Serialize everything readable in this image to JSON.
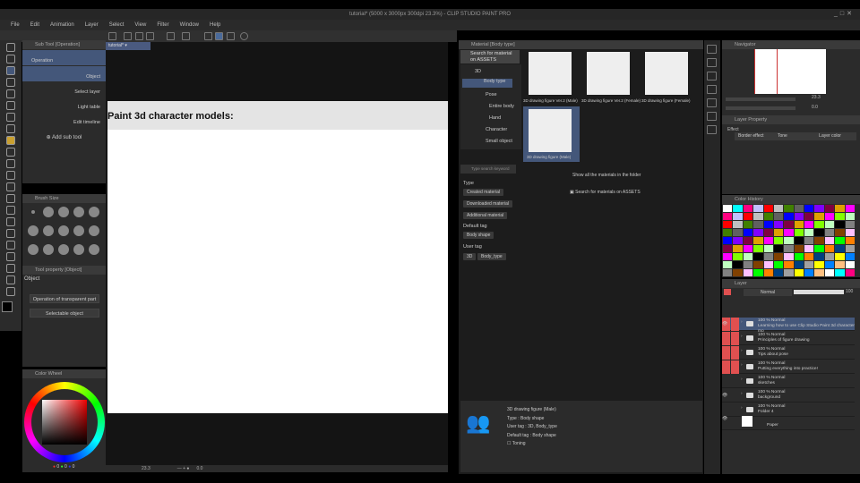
{
  "window": {
    "title": "tutorial* (5000 x 3000px 300dpi 23.3%) - CLIP STUDIO PAINT PRO",
    "controls": [
      "_",
      "□",
      "✕"
    ]
  },
  "menu": [
    "File",
    "Edit",
    "Animation",
    "Layer",
    "Select",
    "View",
    "Filter",
    "Window",
    "Help"
  ],
  "canvas_tab": "tutorial*",
  "subtool": {
    "title": "Sub Tool [Operation]",
    "items": [
      "Operation",
      "Object",
      "Select layer",
      "Light table",
      "Edit timeline"
    ],
    "add": "Add sub tool"
  },
  "brush_size": {
    "title": "Brush Size"
  },
  "tool_property": {
    "title": "Tool property [Object]",
    "object_label": "Object",
    "dropdown1": "Operation of transparent part",
    "dropdown2": "Selectable object"
  },
  "color_wheel": {
    "title": "Color Wheel",
    "r": "0",
    "g": "0",
    "b": "0",
    "main_color": "#000000"
  },
  "document": {
    "heading": "Paint 3d character models:"
  },
  "status": {
    "zoom": "23.3",
    "angle": "0.0"
  },
  "material": {
    "title": "Material [Body type]",
    "search": "Search for material on ASSETS",
    "tree": [
      "3D",
      "Body type",
      "Pose",
      "Entire body",
      "Hand",
      "Character",
      "Small object"
    ],
    "keyword_placeholder": "Type search keyword",
    "type_label": "Type",
    "types": [
      "Created material",
      "Downloaded material",
      "Additional material"
    ],
    "default_tag_label": "Default tag",
    "default_tags": [
      "Body shape"
    ],
    "user_tag_label": "User tag",
    "user_tags": [
      "3D",
      "Body_type"
    ],
    "items": [
      "3D drawing figure Ver.2 (Male)",
      "3D drawing figure Ver.2 (Female)",
      "3D drawing figure (Female)",
      "3D drawing figure (Male)"
    ],
    "show_all": "Show all the materials in the folder",
    "assets_link": "Search for materials on ASSETS",
    "info": {
      "name": "3D drawing figure (Male)",
      "type": "Type : Body shape",
      "user_tag": "User tag : 3D, Body_type",
      "default_tag": "Default tag : Body shape",
      "toning": "Toning"
    }
  },
  "navigator": {
    "title": "Navigator",
    "zoom": "23.3",
    "angle": "0.0"
  },
  "layer_property": {
    "title": "Layer Property",
    "effect_label": "Effect",
    "buttons": [
      "Border effect",
      "Tone",
      "Layer color"
    ]
  },
  "color_history": {
    "title": "Color History",
    "colors": [
      "#ffffff",
      "#000000",
      "#ff0000",
      "#00ff00",
      "#0000ff",
      "#ffff00",
      "#ff00ff",
      "#00ffff",
      "#808080",
      "#c0c0c0",
      "#ff8000",
      "#8000ff",
      "#0080ff",
      "#80ff00",
      "#ff0080",
      "#804000",
      "#408000",
      "#004080",
      "#800040",
      "#ffc080",
      "#c0ffc0",
      "#c0c0ff",
      "#ffc0ff",
      "#606060",
      "#a0a0a0",
      "#e0a000"
    ]
  },
  "layers": {
    "title": "Layer",
    "blend": "Normal",
    "opacity": "100",
    "color": "#e05050",
    "items": [
      {
        "mode": "100 % Normal",
        "name": "Learning how to use Clip Studio Paint 3d character mo",
        "red": true,
        "visible": true,
        "selected": true
      },
      {
        "mode": "100 % Normal",
        "name": "Principles of figure drawing",
        "red": true
      },
      {
        "mode": "100 % Normal",
        "name": "Tips about pose",
        "red": true
      },
      {
        "mode": "100 % Normal",
        "name": "Putting everything into practice!",
        "red": true
      },
      {
        "mode": "100 % Normal",
        "name": "sketches"
      },
      {
        "mode": "100 % Normal",
        "name": "background",
        "visible": true
      },
      {
        "mode": "100 % Normal",
        "name": "Folder 4"
      }
    ],
    "paper": "Paper"
  }
}
